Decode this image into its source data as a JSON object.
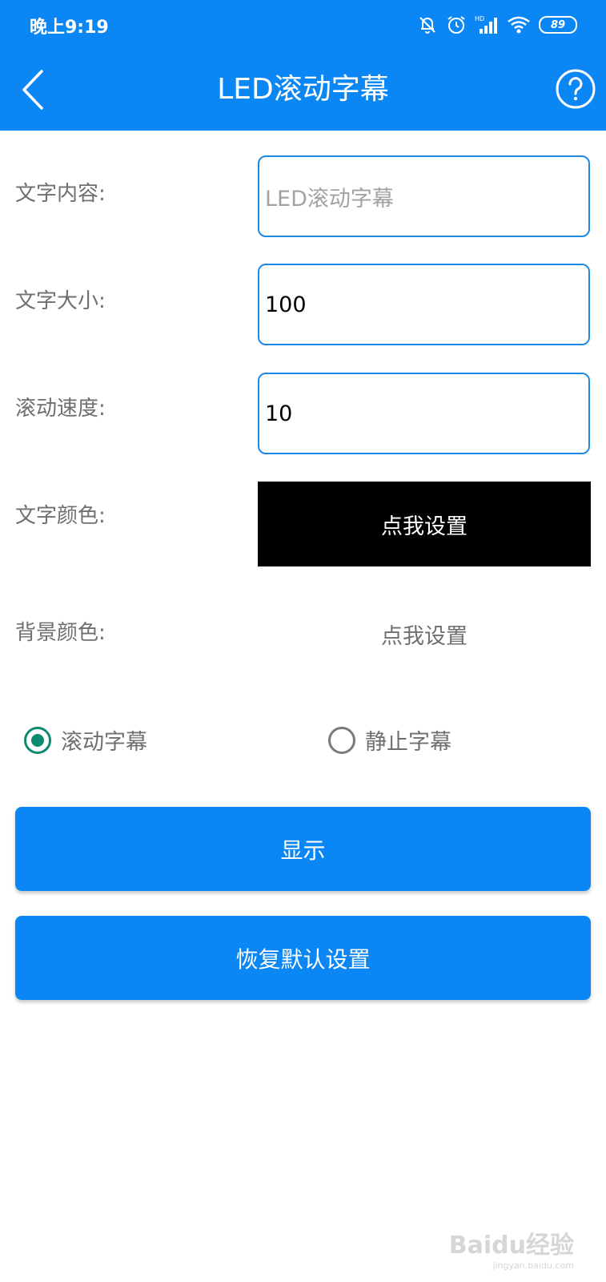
{
  "status_bar": {
    "time": "晚上9:19",
    "battery": "89"
  },
  "app_bar": {
    "title": "LED滚动字幕"
  },
  "form": {
    "content_label": "文字内容:",
    "content_placeholder": "LED滚动字幕",
    "size_label": "文字大小:",
    "size_value": "100",
    "speed_label": "滚动速度:",
    "speed_value": "10",
    "text_color_label": "文字颜色:",
    "text_color_button": "点我设置",
    "bg_color_label": "背景颜色:",
    "bg_color_button": "点我设置"
  },
  "mode": {
    "scroll_label": "滚动字幕",
    "static_label": "静止字幕",
    "selected": "scroll"
  },
  "buttons": {
    "show": "显示",
    "reset": "恢复默认设置"
  },
  "watermark": {
    "brand": "Baidu经验",
    "url": "jingyan.baidu.com"
  },
  "colors": {
    "accent": "#0a86f5",
    "radio_selected": "#0d8a6f",
    "text_color_preview": "#000000"
  }
}
